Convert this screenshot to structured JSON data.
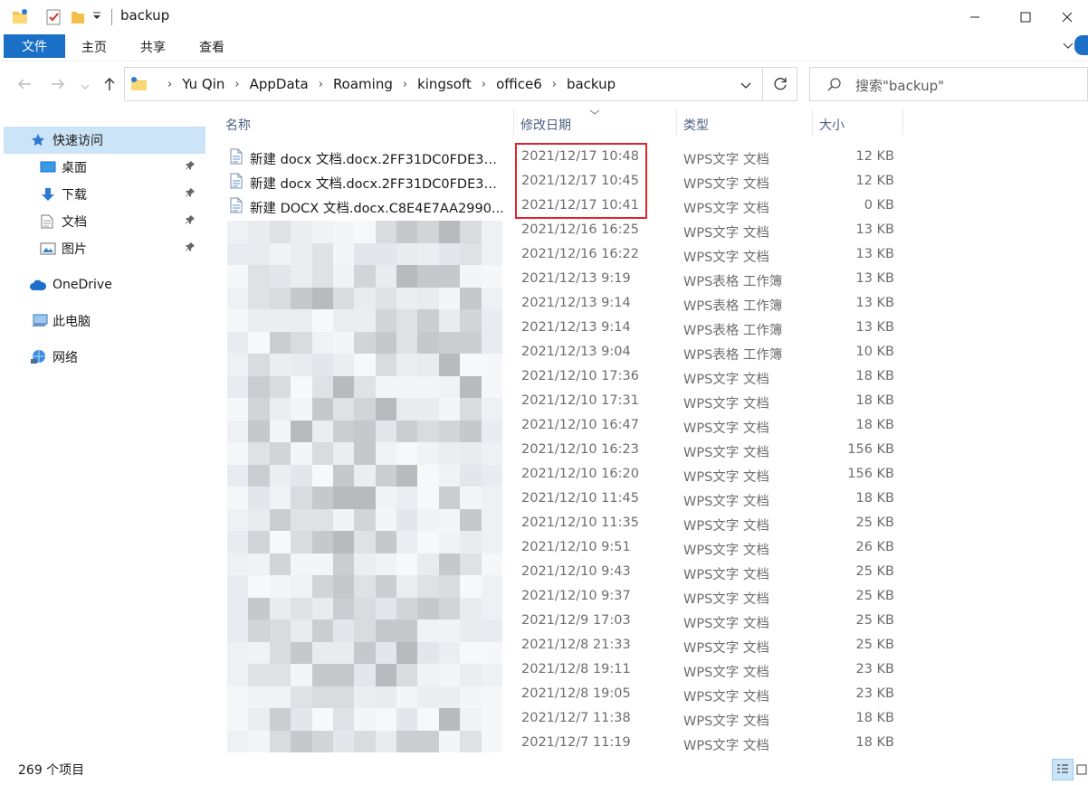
{
  "window": {
    "title": "backup"
  },
  "ribbon": {
    "tabs": [
      "文件",
      "主页",
      "共享",
      "查看"
    ]
  },
  "address": {
    "crumbs": [
      "Yu Qin",
      "AppData",
      "Roaming",
      "kingsoft",
      "office6",
      "backup"
    ]
  },
  "search": {
    "placeholder": "搜索\"backup\""
  },
  "sidebar": {
    "items": [
      {
        "label": "快速访问",
        "icon": "star-icon",
        "pinned": false
      },
      {
        "label": "桌面",
        "icon": "desktop-icon",
        "pinned": true
      },
      {
        "label": "下载",
        "icon": "download-icon",
        "pinned": true
      },
      {
        "label": "文档",
        "icon": "document-icon",
        "pinned": true
      },
      {
        "label": "图片",
        "icon": "picture-icon",
        "pinned": true
      },
      {
        "label": "OneDrive",
        "icon": "cloud-icon",
        "pinned": false
      },
      {
        "label": "此电脑",
        "icon": "computer-icon",
        "pinned": false
      },
      {
        "label": "网络",
        "icon": "network-icon",
        "pinned": false
      }
    ]
  },
  "columns": {
    "name": "名称",
    "date": "修改日期",
    "type": "类型",
    "size": "大小"
  },
  "files": [
    {
      "name": "新建 docx 文档.docx.2FF31DC0FDE3D...",
      "date": "2021/12/17 10:48",
      "type": "WPS文字 文档",
      "size": "12 KB"
    },
    {
      "name": "新建 docx 文档.docx.2FF31DC0FDE3D...",
      "date": "2021/12/17 10:45",
      "type": "WPS文字 文档",
      "size": "12 KB"
    },
    {
      "name": "新建 DOCX 文档.docx.C8E4E7AA2990...",
      "date": "2021/12/17 10:41",
      "type": "WPS文字 文档",
      "size": "0 KB"
    },
    {
      "name": "",
      "date": "2021/12/16 16:25",
      "type": "WPS文字 文档",
      "size": "13 KB"
    },
    {
      "name": "",
      "date": "2021/12/16 16:22",
      "type": "WPS文字 文档",
      "size": "13 KB"
    },
    {
      "name": "",
      "date": "2021/12/13 9:19",
      "type": "WPS表格 工作簿",
      "size": "13 KB"
    },
    {
      "name": "",
      "date": "2021/12/13 9:14",
      "type": "WPS表格 工作簿",
      "size": "13 KB"
    },
    {
      "name": "",
      "date": "2021/12/13 9:14",
      "type": "WPS表格 工作簿",
      "size": "13 KB"
    },
    {
      "name": "",
      "date": "2021/12/13 9:04",
      "type": "WPS表格 工作簿",
      "size": "10 KB"
    },
    {
      "name": "",
      "date": "2021/12/10 17:36",
      "type": "WPS文字 文档",
      "size": "18 KB"
    },
    {
      "name": "",
      "date": "2021/12/10 17:31",
      "type": "WPS文字 文档",
      "size": "18 KB"
    },
    {
      "name": "",
      "date": "2021/12/10 16:47",
      "type": "WPS文字 文档",
      "size": "18 KB"
    },
    {
      "name": "",
      "date": "2021/12/10 16:23",
      "type": "WPS文字 文档",
      "size": "156 KB"
    },
    {
      "name": "",
      "date": "2021/12/10 16:20",
      "type": "WPS文字 文档",
      "size": "156 KB"
    },
    {
      "name": "",
      "date": "2021/12/10 11:45",
      "type": "WPS文字 文档",
      "size": "18 KB"
    },
    {
      "name": "",
      "date": "2021/12/10 11:35",
      "type": "WPS文字 文档",
      "size": "25 KB"
    },
    {
      "name": "",
      "date": "2021/12/10 9:51",
      "type": "WPS文字 文档",
      "size": "26 KB"
    },
    {
      "name": "",
      "date": "2021/12/10 9:43",
      "type": "WPS文字 文档",
      "size": "25 KB"
    },
    {
      "name": "",
      "date": "2021/12/10 9:37",
      "type": "WPS文字 文档",
      "size": "25 KB"
    },
    {
      "name": "",
      "date": "2021/12/9 17:03",
      "type": "WPS文字 文档",
      "size": "25 KB"
    },
    {
      "name": "",
      "date": "2021/12/8 21:33",
      "type": "WPS文字 文档",
      "size": "25 KB"
    },
    {
      "name": "",
      "date": "2021/12/8 19:11",
      "type": "WPS文字 文档",
      "size": "23 KB"
    },
    {
      "name": "",
      "date": "2021/12/8 19:05",
      "type": "WPS文字 文档",
      "size": "23 KB"
    },
    {
      "name": "",
      "date": "2021/12/7 11:38",
      "type": "WPS文字 文档",
      "size": "18 KB"
    },
    {
      "name": "",
      "date": "2021/12/7 11:19",
      "type": "WPS文字 文档",
      "size": "18 KB"
    }
  ],
  "status": {
    "count": "269 个项目"
  },
  "colors": {
    "accent": "#1a6fc7",
    "selection": "#cce4f7",
    "highlight": "#e0242b"
  }
}
